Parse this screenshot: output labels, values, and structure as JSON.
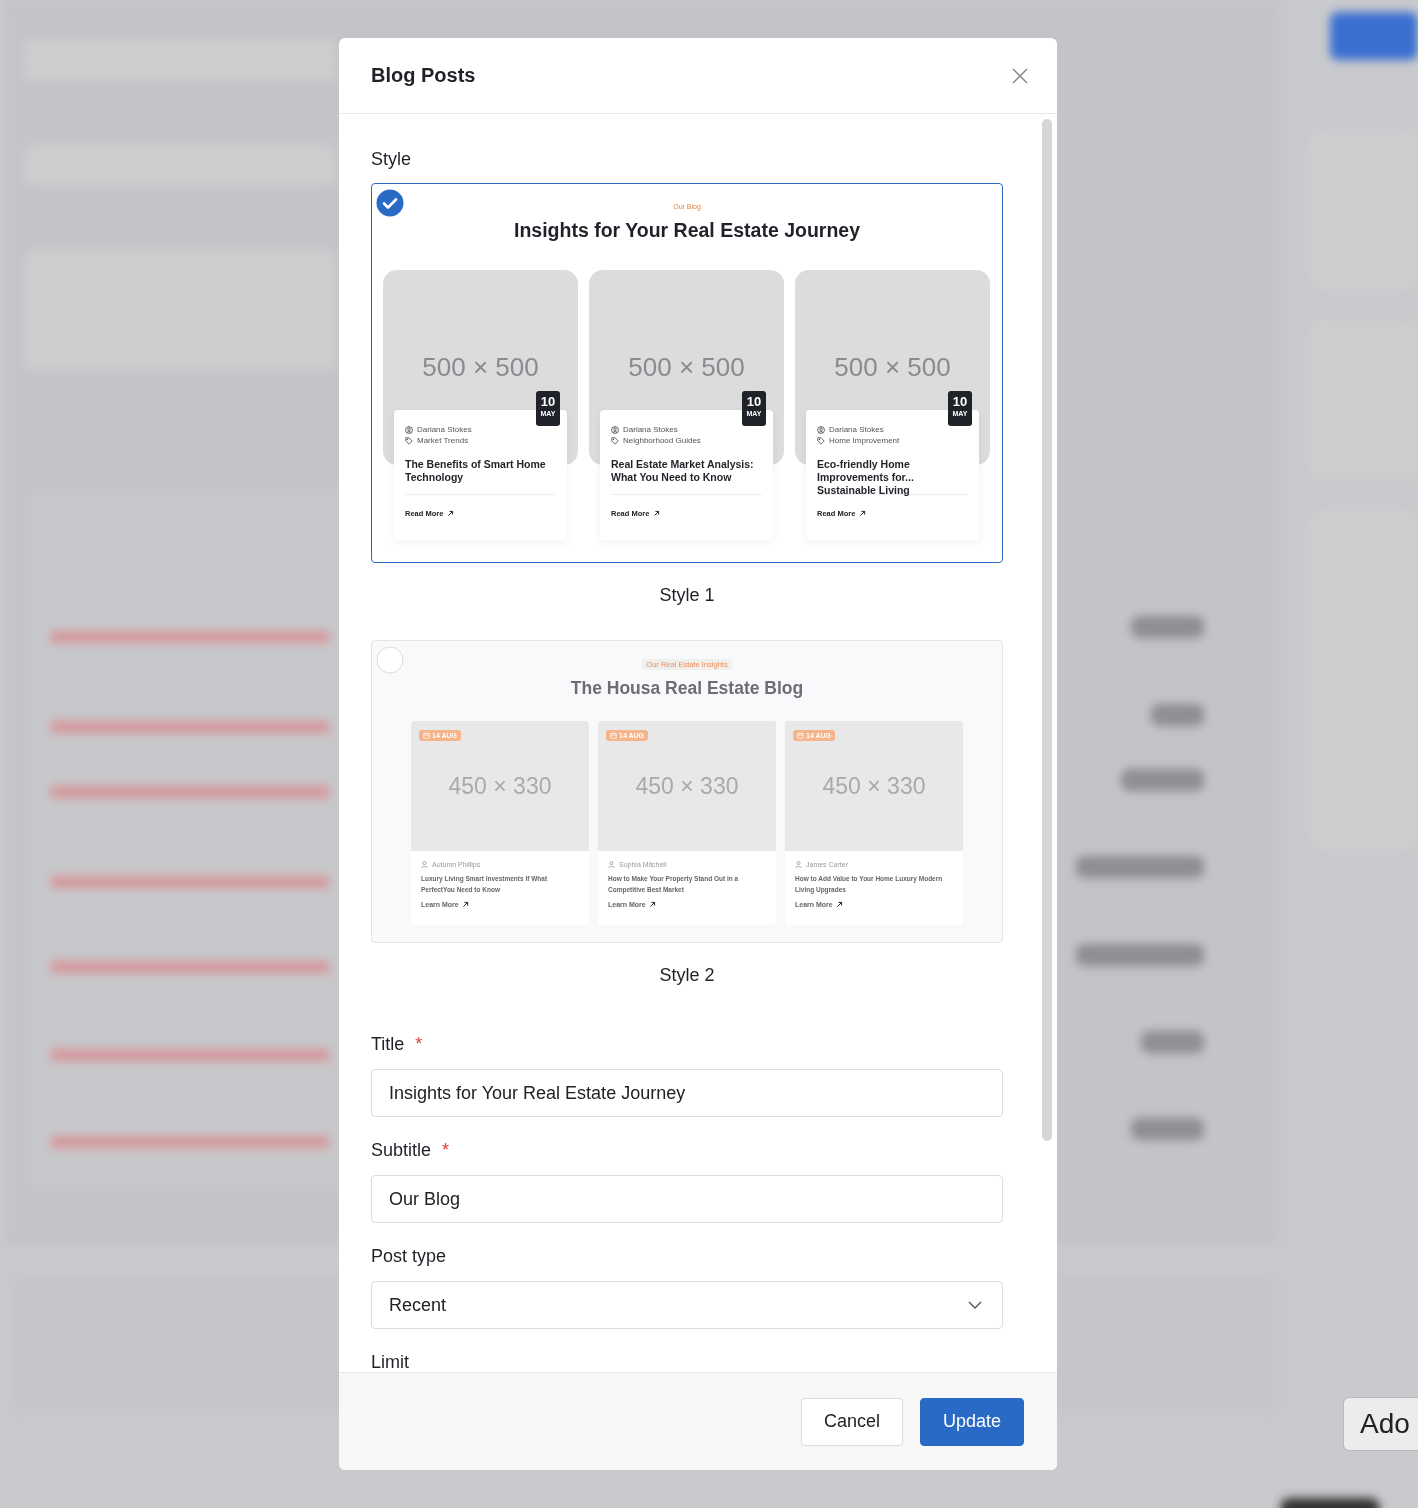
{
  "background": {
    "button": "Ado"
  },
  "dialog": {
    "title": "Blog Posts",
    "style_label": "Style",
    "styles": [
      {
        "kind": "grid",
        "selected": true,
        "label": "Style 1",
        "tagline": "Our Blog",
        "heading": "Insights for Your Real Estate Journey",
        "posts": [
          {
            "image": "500 × 500",
            "day": "10",
            "month": "MAY",
            "author": "Dariana Stokes",
            "category": "Market Trends",
            "title": "The Benefits of Smart Home Technology",
            "link": "Read More"
          },
          {
            "image": "500 × 500",
            "day": "10",
            "month": "MAY",
            "author": "Dariana Stokes",
            "category": "Neighborhood Guides",
            "title": "Real Estate Market Analysis: What You Need to Know",
            "link": "Read More"
          },
          {
            "image": "500 × 500",
            "day": "10",
            "month": "MAY",
            "author": "Dariana Stokes",
            "category": "Home Improvement",
            "title": "Eco-friendly Home Improvements for... Sustainable Living",
            "link": "Read More"
          }
        ]
      },
      {
        "kind": "list",
        "selected": false,
        "label": "Style 2",
        "tagline": "Our Real Estate Insights",
        "heading": "The Housa Real Estate Blog",
        "posts": [
          {
            "image": "450 × 330",
            "date": "14 AUG",
            "author": "Autumn Phillips",
            "title": "Luxury Living Smart Investments If What PerfectYou Need to Know",
            "link": "Learn More"
          },
          {
            "image": "450 × 330",
            "date": "14 AUG",
            "author": "Sophia Mitchell",
            "title": "How to Make Your Property Stand Out in a Competitive Best Market",
            "link": "Learn More"
          },
          {
            "image": "450 × 330",
            "date": "14 AUG",
            "author": "James Carter",
            "title": "How to Add Value to Your Home Luxury Modern Living Upgrades",
            "link": "Learn More"
          }
        ]
      }
    ],
    "fields": [
      {
        "kind": "text",
        "label": "Title",
        "required_mark": "*",
        "value": "Insights for Your Real Estate Journey"
      },
      {
        "kind": "text",
        "label": "Subtitle",
        "required_mark": "*",
        "value": "Our Blog"
      },
      {
        "kind": "select",
        "label": "Post type",
        "value": "Recent"
      },
      {
        "kind": "cut",
        "label": "Limit"
      }
    ],
    "buttons": [
      {
        "kind": "secondary",
        "label": "Cancel"
      },
      {
        "kind": "primary",
        "label": "Update"
      }
    ]
  }
}
